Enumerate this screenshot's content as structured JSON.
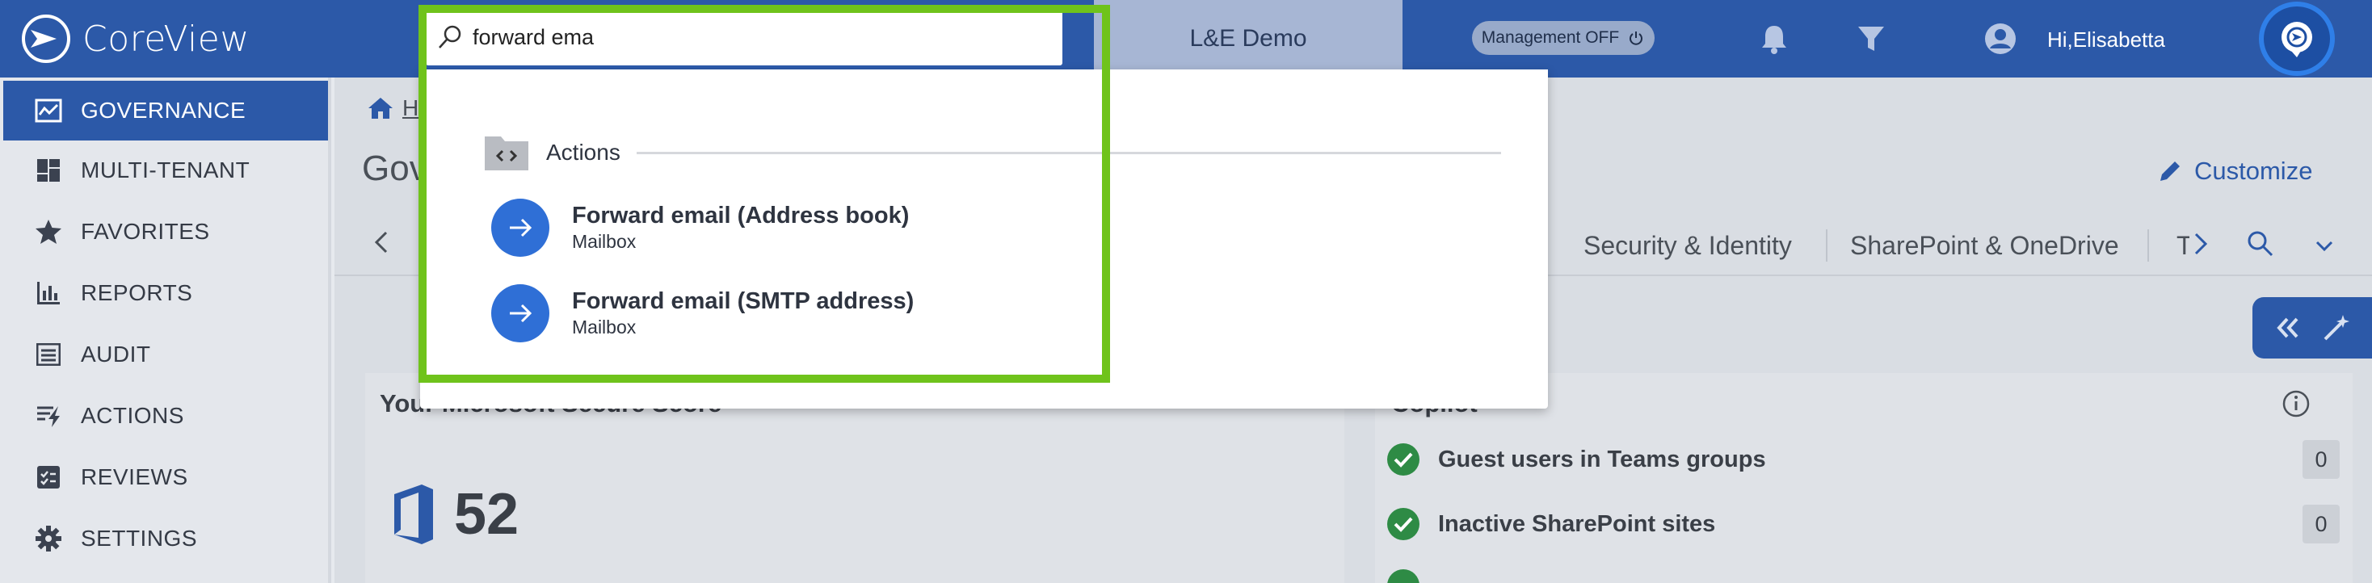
{
  "app": {
    "name": "CoreView"
  },
  "header": {
    "search_value": "forward ema",
    "tenant": "L&E Demo",
    "management_toggle": "Management OFF",
    "greeting": "Hi,Elisabetta"
  },
  "sidebar": {
    "items": [
      {
        "label": "GOVERNANCE",
        "icon": "governance-icon",
        "active": true
      },
      {
        "label": "MULTI-TENANT",
        "icon": "dashboard-icon",
        "active": false
      },
      {
        "label": "FAVORITES",
        "icon": "star-icon",
        "active": false
      },
      {
        "label": "REPORTS",
        "icon": "bar-chart-icon",
        "active": false
      },
      {
        "label": "AUDIT",
        "icon": "list-icon",
        "active": false
      },
      {
        "label": "ACTIONS",
        "icon": "actions-icon",
        "active": false
      },
      {
        "label": "REVIEWS",
        "icon": "review-check-icon",
        "active": false
      },
      {
        "label": "SETTINGS",
        "icon": "gear-icon",
        "active": false
      }
    ]
  },
  "main": {
    "breadcrumb_home": "H",
    "page_title": "Gov",
    "customize": "Customize",
    "tabs": [
      "Security & Identity",
      "SharePoint & OneDrive",
      "T"
    ],
    "secure_score_title": "Your Microsoft Secure Score",
    "secure_score_value": "52",
    "copilot_title": "Copilot",
    "copilot_rows": [
      {
        "label": "Guest users in Teams groups",
        "count": "0"
      },
      {
        "label": "Inactive SharePoint sites",
        "count": "0"
      }
    ]
  },
  "search_results": {
    "section": "Actions",
    "items": [
      {
        "title": "Forward email (Address book)",
        "subtitle": "Mailbox"
      },
      {
        "title": "Forward email (SMTP address)",
        "subtitle": "Mailbox"
      }
    ]
  },
  "colors": {
    "brand": "#2c59a8",
    "highlight": "#6fc31b",
    "action_circle": "#2f6fd6"
  }
}
